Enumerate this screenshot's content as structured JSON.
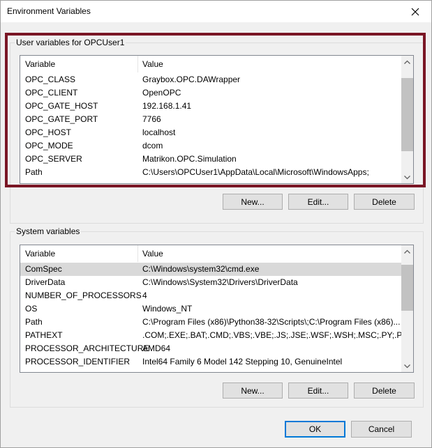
{
  "window": {
    "title": "Environment Variables"
  },
  "user_vars": {
    "label": "User variables for OPCUser1",
    "headers": [
      "Variable",
      "Value"
    ],
    "rows": [
      {
        "name": "OPC_CLASS",
        "value": "Graybox.OPC.DAWrapper"
      },
      {
        "name": "OPC_CLIENT",
        "value": "OpenOPC"
      },
      {
        "name": "OPC_GATE_HOST",
        "value": "192.168.1.41"
      },
      {
        "name": "OPC_GATE_PORT",
        "value": "7766"
      },
      {
        "name": "OPC_HOST",
        "value": "localhost"
      },
      {
        "name": "OPC_MODE",
        "value": "dcom"
      },
      {
        "name": "OPC_SERVER",
        "value": "Matrikon.OPC.Simulation"
      },
      {
        "name": "Path",
        "value": "C:\\Users\\OPCUser1\\AppData\\Local\\Microsoft\\WindowsApps;"
      }
    ],
    "buttons": {
      "new": "New...",
      "edit": "Edit...",
      "delete": "Delete"
    }
  },
  "system_vars": {
    "label": "System variables",
    "headers": [
      "Variable",
      "Value"
    ],
    "rows": [
      {
        "name": "ComSpec",
        "value": "C:\\Windows\\system32\\cmd.exe"
      },
      {
        "name": "DriverData",
        "value": "C:\\Windows\\System32\\Drivers\\DriverData"
      },
      {
        "name": "NUMBER_OF_PROCESSORS",
        "value": "4"
      },
      {
        "name": "OS",
        "value": "Windows_NT"
      },
      {
        "name": "Path",
        "value": "C:\\Program Files (x86)\\Python38-32\\Scripts\\;C:\\Program Files (x86)..."
      },
      {
        "name": "PATHEXT",
        "value": ".COM;.EXE;.BAT;.CMD;.VBS;.VBE;.JS;.JSE;.WSF;.WSH;.MSC;.PY;.PYW"
      },
      {
        "name": "PROCESSOR_ARCHITECTURE",
        "value": "AMD64"
      },
      {
        "name": "PROCESSOR_IDENTIFIER",
        "value": "Intel64 Family 6 Model 142 Stepping 10, GenuineIntel"
      }
    ],
    "selected_row": 0,
    "buttons": {
      "new": "New...",
      "edit": "Edit...",
      "delete": "Delete"
    }
  },
  "footer": {
    "ok": "OK",
    "cancel": "Cancel"
  },
  "colors": {
    "highlight_border": "#7a1625",
    "default_button_border": "#0078d7",
    "selected_row": "#d9d9d9"
  }
}
